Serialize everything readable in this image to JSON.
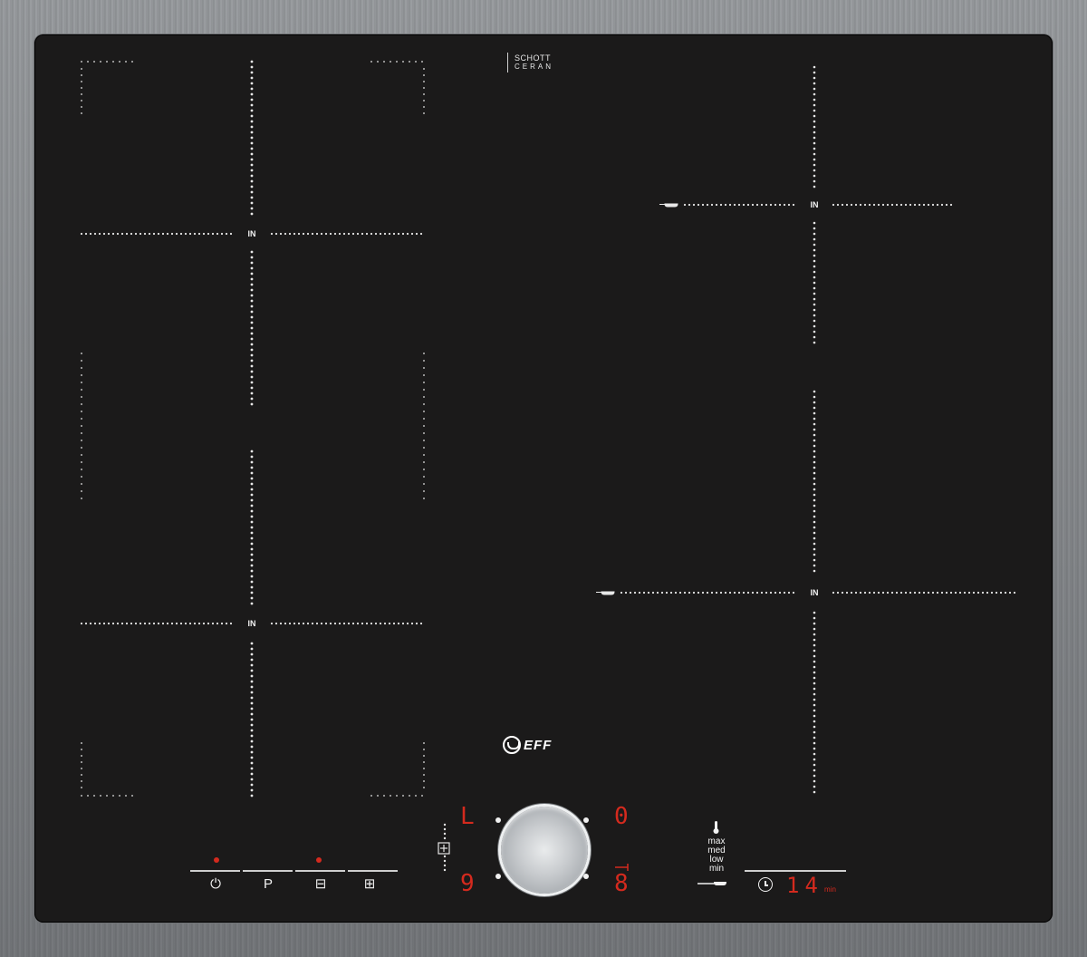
{
  "zone_label": "IN",
  "glass_brand": {
    "line1": "SCHOTT",
    "line2": "CERAN"
  },
  "logo_text": "EFF",
  "displays": {
    "top_left": "L",
    "top_right": "0",
    "bottom_left": "9",
    "bottom_right": "8",
    "timer_value": "14",
    "timer_unit": "min"
  },
  "temperature_levels": [
    "max",
    "med",
    "low",
    "min"
  ],
  "controls": [
    {
      "name": "power",
      "glyph": "⏻"
    },
    {
      "name": "program",
      "glyph": "P"
    },
    {
      "name": "flexzone",
      "glyph": "⊟"
    },
    {
      "name": "boost",
      "glyph": "⊞"
    }
  ],
  "colors": {
    "display_red": "#d42a1e",
    "glass": "#1b1a1a",
    "frame": "#b0b2b4"
  }
}
